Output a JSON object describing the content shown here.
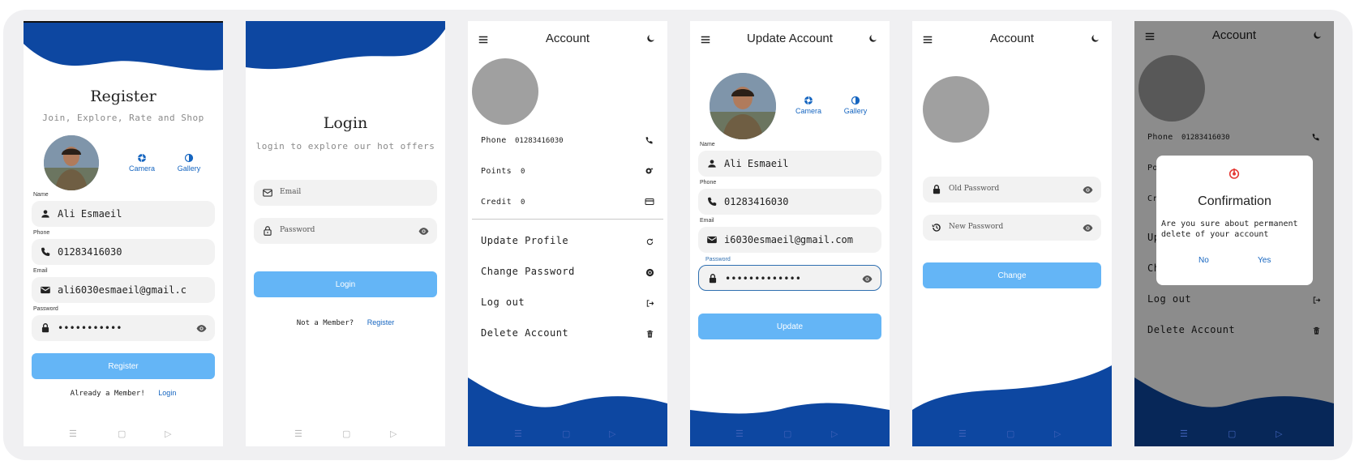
{
  "colors": {
    "brand_blue": "#0d47a1",
    "button_blue": "#64b5f6",
    "link_blue": "#1565c0"
  },
  "register": {
    "title": "Register",
    "subtitle": "Join, Explore, Rate and Shop",
    "camera_label": "Camera",
    "gallery_label": "Gallery",
    "name_label": "Name",
    "name_value": "Ali Esmaeil",
    "phone_label": "Phone",
    "phone_value": "01283416030",
    "email_label": "Email",
    "email_value": "ali6030esmaeil@gmail.c",
    "password_label": "Password",
    "password_value": "•••••••••••",
    "button_label": "Register",
    "footer_text": "Already a Member!",
    "footer_link": "Login"
  },
  "login": {
    "title": "Login",
    "subtitle": "login to explore our hot offers",
    "email_placeholder": "Email",
    "password_placeholder": "Password",
    "button_label": "Login",
    "footer_text": "Not a Member?",
    "footer_link": "Register"
  },
  "account": {
    "title": "Account",
    "phone_label": "Phone",
    "phone_value": "01283416030",
    "points_label": "Points",
    "points_value": "0",
    "credit_label": "Credit",
    "credit_value": "0",
    "actions": [
      "Update Profile",
      "Change Password",
      "Log out",
      "Delete Account"
    ]
  },
  "update": {
    "title": "Update Account",
    "camera_label": "Camera",
    "gallery_label": "Gallery",
    "name_label": "Name",
    "name_value": "Ali Esmaeil",
    "phone_label": "Phone",
    "phone_value": "01283416030",
    "email_label": "Email",
    "email_value": "i6030esmaeil@gmail.com",
    "password_label": "Password",
    "password_value": "•••••••••••••",
    "button_label": "Update"
  },
  "change_password": {
    "title": "Account",
    "old_placeholder": "Old Password",
    "new_placeholder": "New Password",
    "button_label": "Change"
  },
  "delete_dialog": {
    "title": "Account",
    "phone_label": "Phone",
    "phone_value": "01283416030",
    "points_partial": "Po",
    "credit_partial": "Cr",
    "update_partial": "Up",
    "change_partial": "Ch",
    "logout_label": "Log out",
    "delete_label": "Delete Account",
    "dialog_title": "Confirmation",
    "dialog_message": "Are you sure about permanent delete of your account",
    "no_label": "No",
    "yes_label": "Yes"
  },
  "nav_icons": [
    "menu-lines-icon",
    "square-icon",
    "triangle-icon"
  ]
}
